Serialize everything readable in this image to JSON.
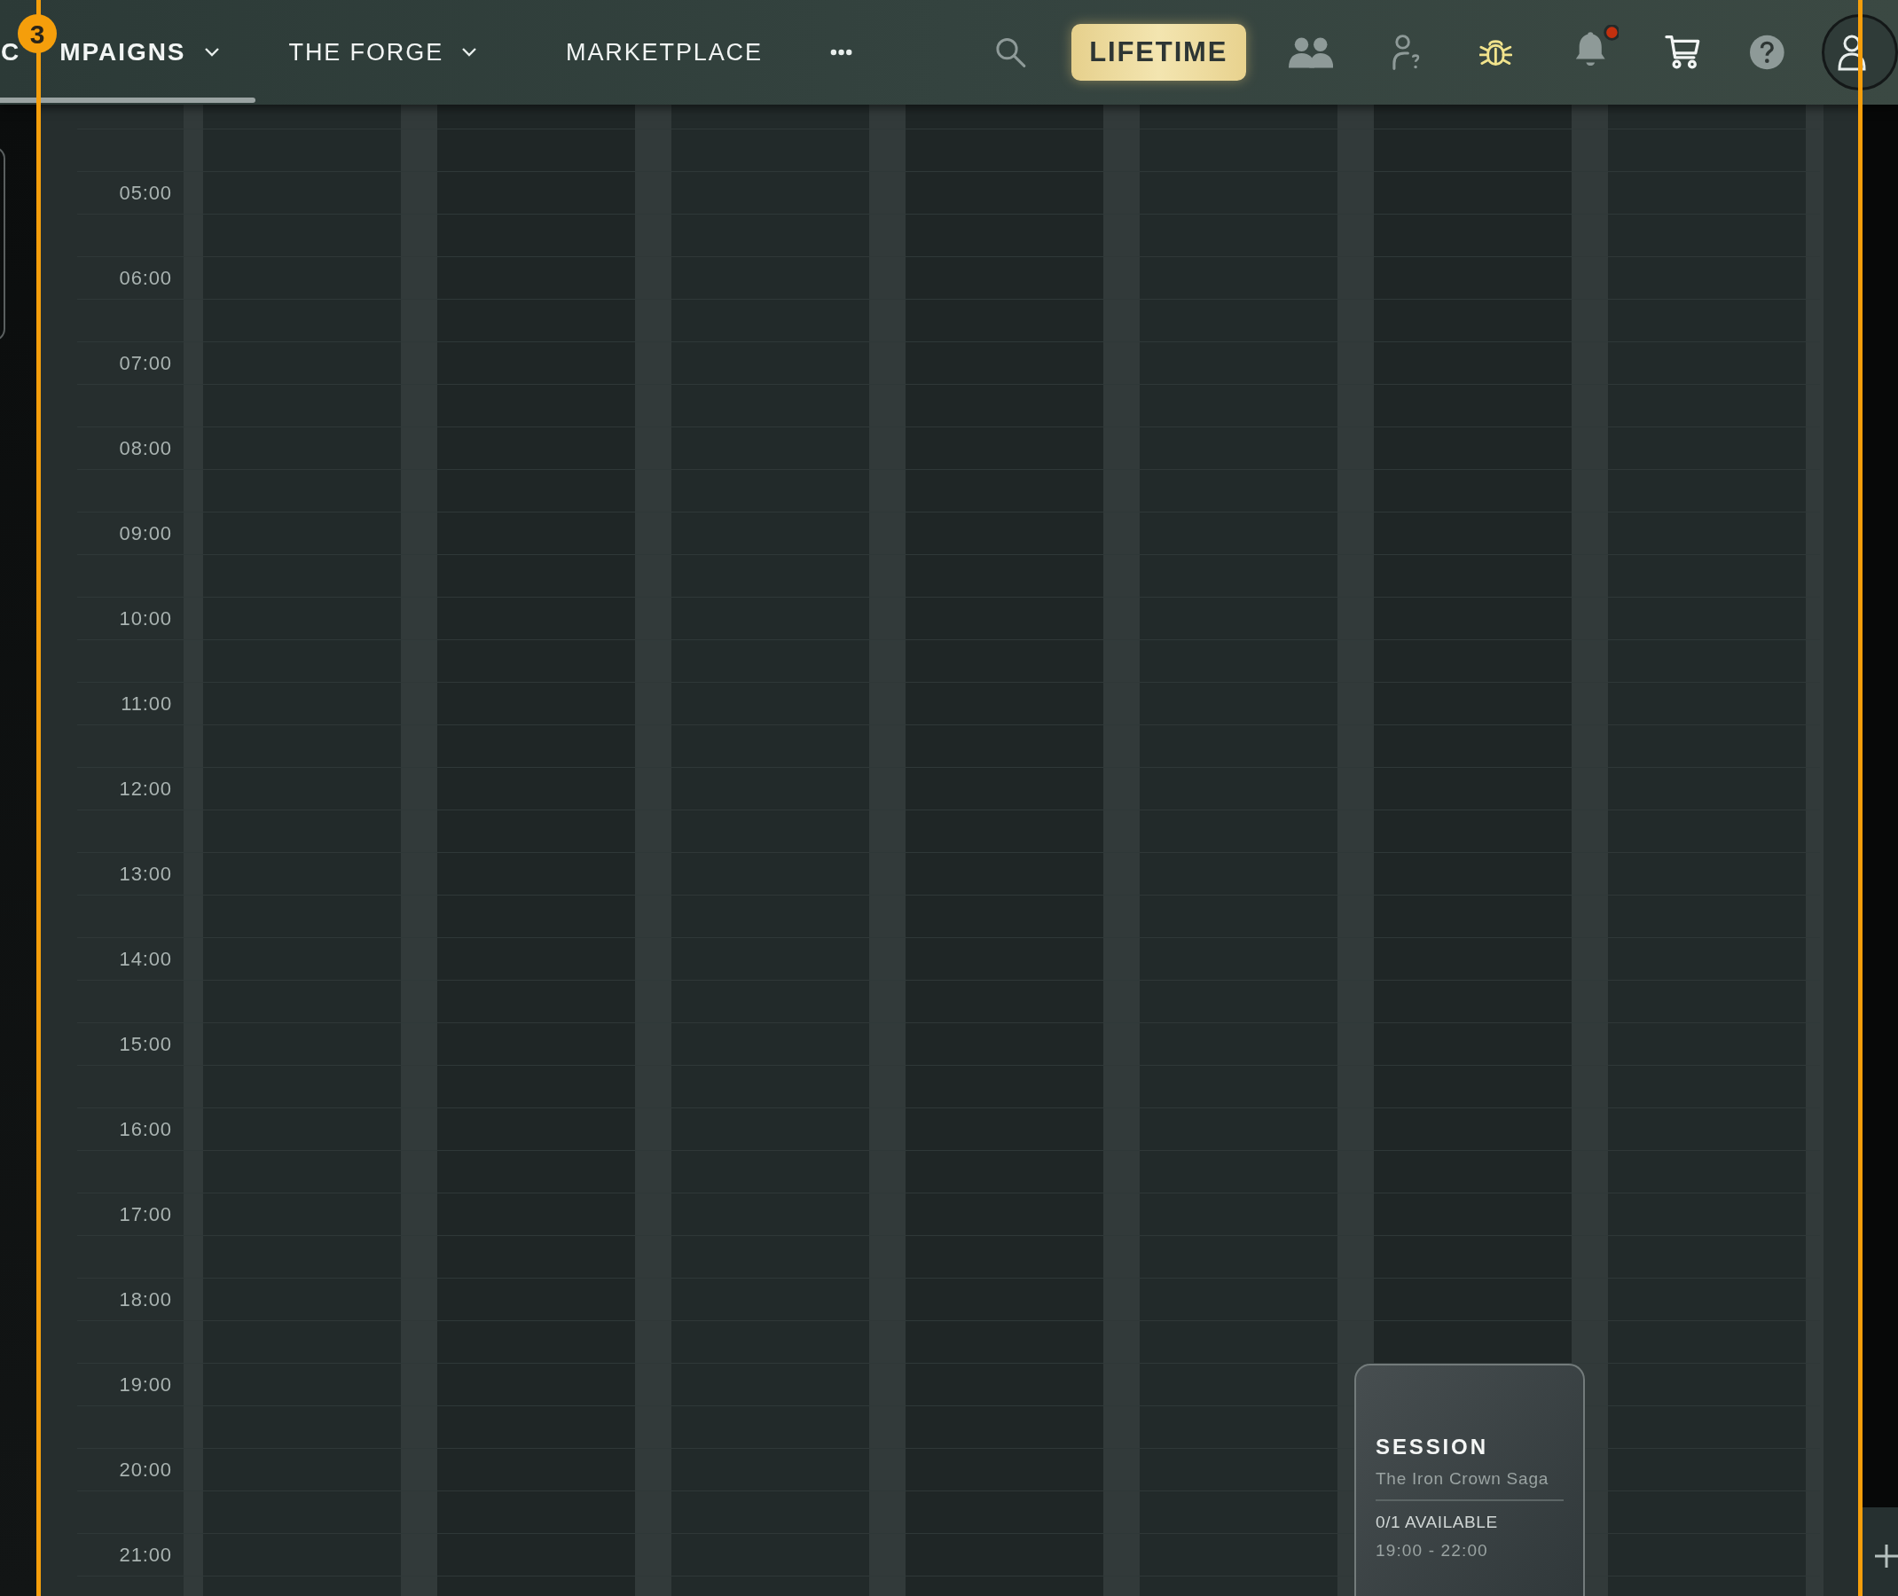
{
  "nav": {
    "tabs": [
      {
        "label_parts": [
          "C",
          "MPAIGNS"
        ],
        "dropdown": true,
        "selected": true
      },
      {
        "label": "THE FORGE",
        "dropdown": true,
        "selected": false
      },
      {
        "label": "MARKETPLACE",
        "dropdown": false,
        "selected": false
      }
    ],
    "upgrade_button": "LIFETIME",
    "notifications_unread": true
  },
  "tour_step": "3",
  "calendar": {
    "hours": [
      "05:00",
      "06:00",
      "07:00",
      "08:00",
      "09:00",
      "10:00",
      "11:00",
      "12:00",
      "13:00",
      "14:00",
      "15:00",
      "16:00",
      "17:00",
      "18:00",
      "19:00",
      "20:00",
      "21:00"
    ],
    "events": [
      {
        "title": "SESSION",
        "campaign": "The Iron Crown Saga",
        "availability": "0/1 AVAILABLE",
        "time": "19:00 - 22:00"
      }
    ]
  }
}
